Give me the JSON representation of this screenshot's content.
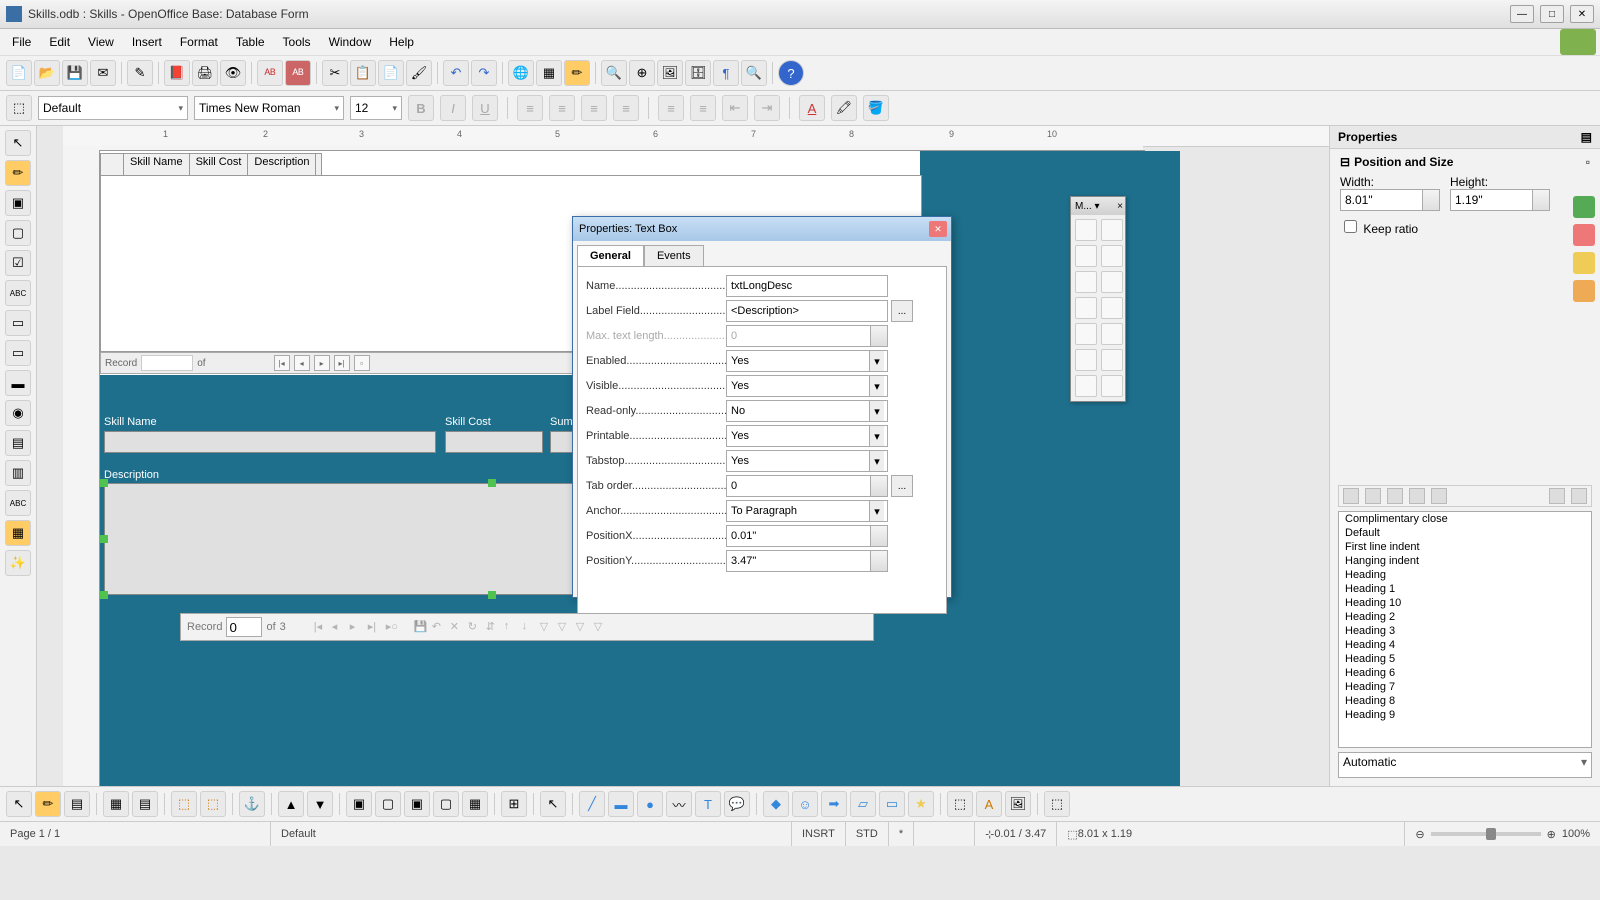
{
  "window": {
    "title": "Skills.odb : Skills - OpenOffice Base: Database Form"
  },
  "menu": [
    "File",
    "Edit",
    "View",
    "Insert",
    "Format",
    "Table",
    "Tools",
    "Window",
    "Help"
  ],
  "toolbar2": {
    "style": "Default",
    "font": "Times New Roman",
    "size": "12"
  },
  "canvas": {
    "subform_cols": [
      "Skill Name",
      "Skill Cost",
      "Description"
    ],
    "recordbar": {
      "label": "Record",
      "of": "of"
    },
    "labels": {
      "skillname": "Skill Name",
      "skillcost": "Skill Cost",
      "summary": "Summar",
      "description": "Description"
    },
    "nav": {
      "record": "Record",
      "value": "0",
      "of": "of",
      "total": "3"
    }
  },
  "dialog": {
    "title": "Properties: Text Box",
    "tabs": [
      "General",
      "Events"
    ],
    "props": [
      {
        "label": "Name",
        "dots": "...............................................",
        "value": "txtLongDesc",
        "type": "text"
      },
      {
        "label": "Label Field",
        "dots": ".....................................",
        "value": "<Description>",
        "type": "text",
        "more": true
      },
      {
        "label": "Max. text length",
        "dots": "...........................",
        "value": "0",
        "type": "spin",
        "disabled": true
      },
      {
        "label": "Enabled",
        "dots": "............................................",
        "value": "Yes",
        "type": "dd"
      },
      {
        "label": "Visible",
        "dots": "..............................................",
        "value": "Yes",
        "type": "dd"
      },
      {
        "label": "Read-only",
        "dots": ".......................................",
        "value": "No",
        "type": "dd"
      },
      {
        "label": "Printable",
        "dots": ".........................................",
        "value": "Yes",
        "type": "dd"
      },
      {
        "label": "Tabstop",
        "dots": "...........................................",
        "value": "Yes",
        "type": "dd"
      },
      {
        "label": "Tab order",
        "dots": ".......................................",
        "value": "0",
        "type": "spin",
        "more": true
      },
      {
        "label": "Anchor",
        "dots": "............................................",
        "value": "To Paragraph",
        "type": "dd"
      },
      {
        "label": "PositionX",
        "dots": ".......................................",
        "value": "0.01\"",
        "type": "spin"
      },
      {
        "label": "PositionY",
        "dots": ".......................................",
        "value": "3.47\"",
        "type": "spin"
      }
    ]
  },
  "more_palette": {
    "title": "M...  ▾"
  },
  "rp": {
    "title": "Properties",
    "section": "Position and Size",
    "width_label": "Width:",
    "height_label": "Height:",
    "width": "8.01\"",
    "height": "1.19\"",
    "keepratio": "Keep ratio"
  },
  "styles": [
    "Complimentary close",
    "Default",
    "First line indent",
    "Hanging indent",
    "Heading",
    "Heading 1",
    "Heading 10",
    "Heading 2",
    "Heading 3",
    "Heading 4",
    "Heading 5",
    "Heading 6",
    "Heading 7",
    "Heading 8",
    "Heading 9"
  ],
  "style_filter": "Automatic",
  "status": {
    "page": "Page 1 / 1",
    "style": "Default",
    "insrt": "INSRT",
    "std": "STD",
    "star": "*",
    "pos": "0.01 / 3.47",
    "size": "8.01 x 1.19",
    "zoom": "100%"
  }
}
